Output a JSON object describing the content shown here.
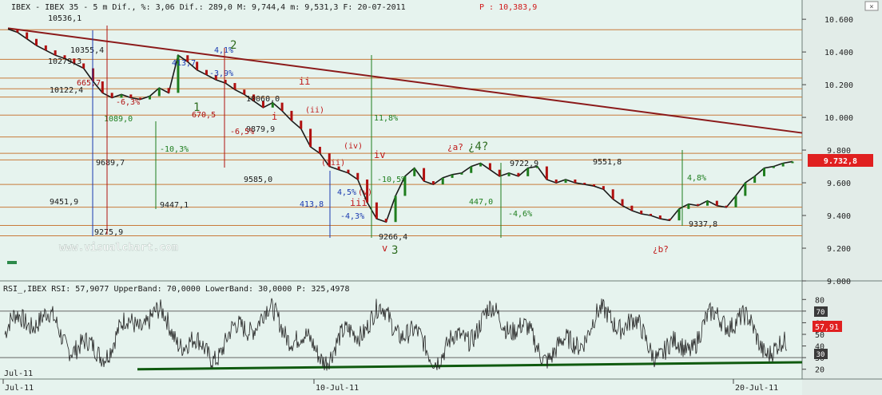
{
  "header": {
    "text": "IBEX - IBEX 35 - 5 m Dif., %: 3,06 Dif.: 289,0 M: 9,744,4 m: 9,531,3 F: 20-07-2011",
    "price_text": "P : 10,383,9"
  },
  "watermark": "www.visualchart.com",
  "price_panel": {
    "axis_ticks": [
      "10.600",
      "10.400",
      "10.200",
      "10.000",
      "9.800",
      "9.600",
      "9.400",
      "9.200",
      "9.000"
    ],
    "last_price_label": "9.732,8",
    "colors": {
      "trendline": "#8b1a1a",
      "up": "#1e7e1e",
      "down": "#b01010",
      "candle": "#1a1a1a",
      "h_lines": "#c87a3a",
      "last_price_bg": "#e02020"
    }
  },
  "chart_data": {
    "type": "line",
    "title": "IBEX 35 - 5 m",
    "ylim": [
      9000,
      10630
    ],
    "x": [
      "Jul-11",
      "10-Jul-11",
      "20-Jul-11"
    ],
    "series": [
      {
        "values": [
          10540,
          10520,
          10480,
          10440,
          10410,
          10380,
          10360,
          10330,
          10300,
          10220,
          10150,
          10120,
          10140,
          10120,
          10110,
          10130,
          10180,
          10150,
          10380,
          10340,
          10290,
          10260,
          10230,
          10210,
          10170,
          10140,
          10100,
          10060,
          10090,
          10040,
          9980,
          9930,
          9820,
          9780,
          9700,
          9680,
          9660,
          9620,
          9480,
          9380,
          9360,
          9520,
          9640,
          9690,
          9610,
          9590,
          9630,
          9650,
          9660,
          9700,
          9720,
          9680,
          9640,
          9660,
          9640,
          9690,
          9700,
          9620,
          9600,
          9620,
          9600,
          9590,
          9580,
          9560,
          9500,
          9460,
          9430,
          9410,
          9400,
          9380,
          9370,
          9440,
          9470,
          9460,
          9490,
          9460,
          9450,
          9520,
          9600,
          9640,
          9690,
          9700,
          9720,
          9730
        ]
      }
    ],
    "price_levels": [
      "10536,1",
      "10355,4",
      "10279,3",
      "10122,4",
      "10060,0",
      "9879,9",
      "9722,9",
      "9585,0",
      "9551,8",
      "9451,9",
      "9447,1",
      "9337,8",
      "9275,9",
      "9266,4"
    ],
    "moves": [
      "-6,3%",
      "-10,3%",
      "-10,5%",
      "11,8%",
      "-4,6%",
      "4,8%",
      "4,5%",
      "-4,3%",
      "-3,9%",
      "4,1%",
      "-6,5%"
    ],
    "distances": [
      "665,7",
      "670,5",
      "413,7",
      "413,8",
      "447,0",
      "1089,0",
      "9689,7"
    ],
    "wave_labels": [
      "1",
      "2",
      "3",
      "i",
      "ii",
      "iii",
      "iv",
      "v",
      "¿a?",
      "¿4?",
      "¿b?",
      "(ii)",
      "(iv)",
      "(iii)",
      "(v)"
    ]
  },
  "rsi_panel": {
    "header": "RSI_,IBEX RSI: 57,9077 UpperBand: 70,0000 LowerBand: 30,0000 P: 325,4978",
    "axis_ticks": [
      "80",
      "70",
      "60",
      "50",
      "40",
      "30",
      "20"
    ],
    "current_label": "57,91",
    "upper_band_label": "70",
    "lower_band_label": "30",
    "colors": {
      "line": "#222222",
      "overbought": "#1e6ed8",
      "oversold": "#c01818",
      "trend": "#0f5a0f"
    }
  },
  "x_axis": {
    "labels": [
      "Jul-11",
      "10-Jul-11",
      "20-Jul-11"
    ]
  }
}
